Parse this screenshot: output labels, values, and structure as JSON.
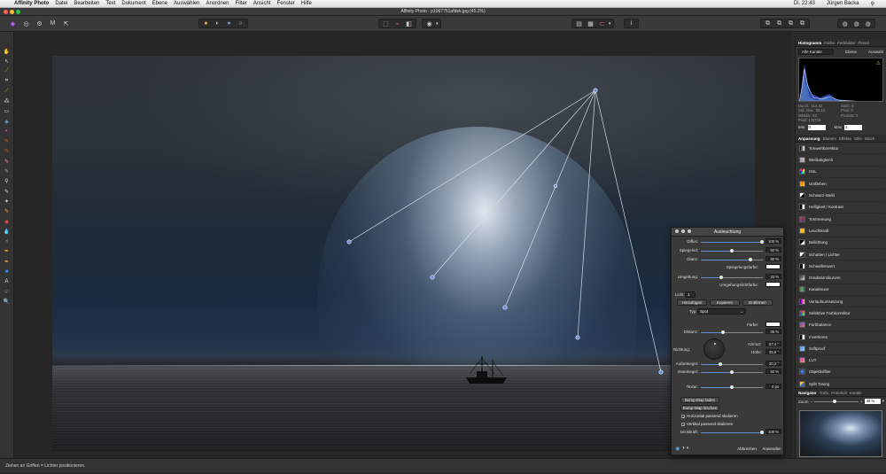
{
  "menubar": {
    "items": [
      "Affinity Photo",
      "Datei",
      "Bearbeiten",
      "Text",
      "Dokument",
      "Ebene",
      "Auswählen",
      "Anordnen",
      "Filter",
      "Ansicht",
      "Fenster",
      "Hilfe"
    ],
    "clock": "Di. 22:43",
    "user": "Jürgen Backa"
  },
  "window": {
    "title": "Affinity Photo - p1067751afdek.jpg (45.2%)"
  },
  "status": {
    "text": "Ziehen an Griffen = Lichter positionieren."
  },
  "histogram": {
    "tabs": [
      "Histogramm",
      "Farbe",
      "Farbfelder",
      "Pinsel"
    ],
    "channel": "Alle Kanäle",
    "layer_label": "Ebene",
    "selection_label": "Auswahl",
    "stats": [
      "Durch.: 114,42",
      "Std. Abw.: 89,13",
      "Mittelw.: 62",
      "Pixel: 176715"
    ],
    "stats_right": [
      "Stufe: 0",
      "Pixel: 0",
      "Prozent: 0"
    ],
    "min_label": "Min:",
    "min_value": "0",
    "max_label": "Max:",
    "max_value": "1"
  },
  "adjust": {
    "tabs": [
      "Anpassung",
      "Ebenen",
      "Effekte",
      "Stile",
      "Stock"
    ],
    "items": [
      "Tonwertkorrektur",
      "Weißabgleich",
      "HSL",
      "Umfärben",
      "Schwarz-Weiß",
      "Helligkeit / Kontrast",
      "Tontrennung",
      "Leuchtkraft",
      "Belichtung",
      "Schatten / Lichter",
      "Schwellenwert",
      "Gradationskurven",
      "Kanalmixer",
      "Verlaufsumsetzung",
      "Selektive Farbkorrektur",
      "Farbbalance",
      "Invertieren",
      "Softproof",
      "LUT",
      "Objektivfilter",
      "Split Toning"
    ]
  },
  "navigator": {
    "tabs": [
      "Navigator",
      "Trafo",
      "Protokoll",
      "Kanäle"
    ],
    "zoom_label": "Zoom",
    "zoom_value": "45 %"
  },
  "dialog": {
    "title": "Ausleuchtung",
    "diffus": {
      "label": "Diffus:",
      "value": "100 %",
      "frac": 0.98
    },
    "spiegelnd": {
      "label": "Spiegelnd:",
      "value": "50 %",
      "frac": 0.5
    },
    "glanz": {
      "label": "Glanz:",
      "value": "80 %",
      "frac": 0.8
    },
    "spiegelfarbe": "Spiegelungsfarbe:",
    "umgebung": {
      "label": "Umgebung:",
      "value": "33 %",
      "frac": 0.33
    },
    "umgebungsfarbe": "Umgebungslichtfarbe:",
    "licht_label": "Licht:",
    "licht_value": "1",
    "btn_add": "Hinzufügen",
    "btn_copy": "Kopieren",
    "btn_remove": "Entfernen",
    "typ_label": "Typ:",
    "typ_value": "Spot",
    "farbe_label": "Farbe:",
    "distanz": {
      "label": "Distanz:",
      "value": "36 %",
      "frac": 0.36
    },
    "richtung": "Richtung:",
    "azimut_label": "Azimut:",
    "azimut_value": "67,4 °",
    "hoehe_label": "Höhe:",
    "hoehe_value": "35,8 °",
    "aussenkegel": {
      "label": "Außenkegel:",
      "value": "30,2 °",
      "frac": 0.32
    },
    "innenkegel": {
      "label": "Innenkegel:",
      "value": "50 %",
      "frac": 0.5
    },
    "textur": {
      "label": "Textur:",
      "value": "0 px",
      "frac": 0.5
    },
    "btn_bump_load": "Bump-Map laden",
    "btn_bump_clear": "Bump-Map löschen",
    "chk_h": "Horizontal passend skalieren",
    "chk_v": "Vertikal passend skalieren",
    "deckkraft": {
      "label": "Deckkraft:",
      "value": "100 %",
      "frac": 0.98
    },
    "btn_cancel": "Abbrechen",
    "btn_apply": "Anwenden"
  },
  "colors": {
    "accent": "#5a8fd6",
    "close": "#ff5f57",
    "min": "#febc2e",
    "max": "#28c840"
  }
}
